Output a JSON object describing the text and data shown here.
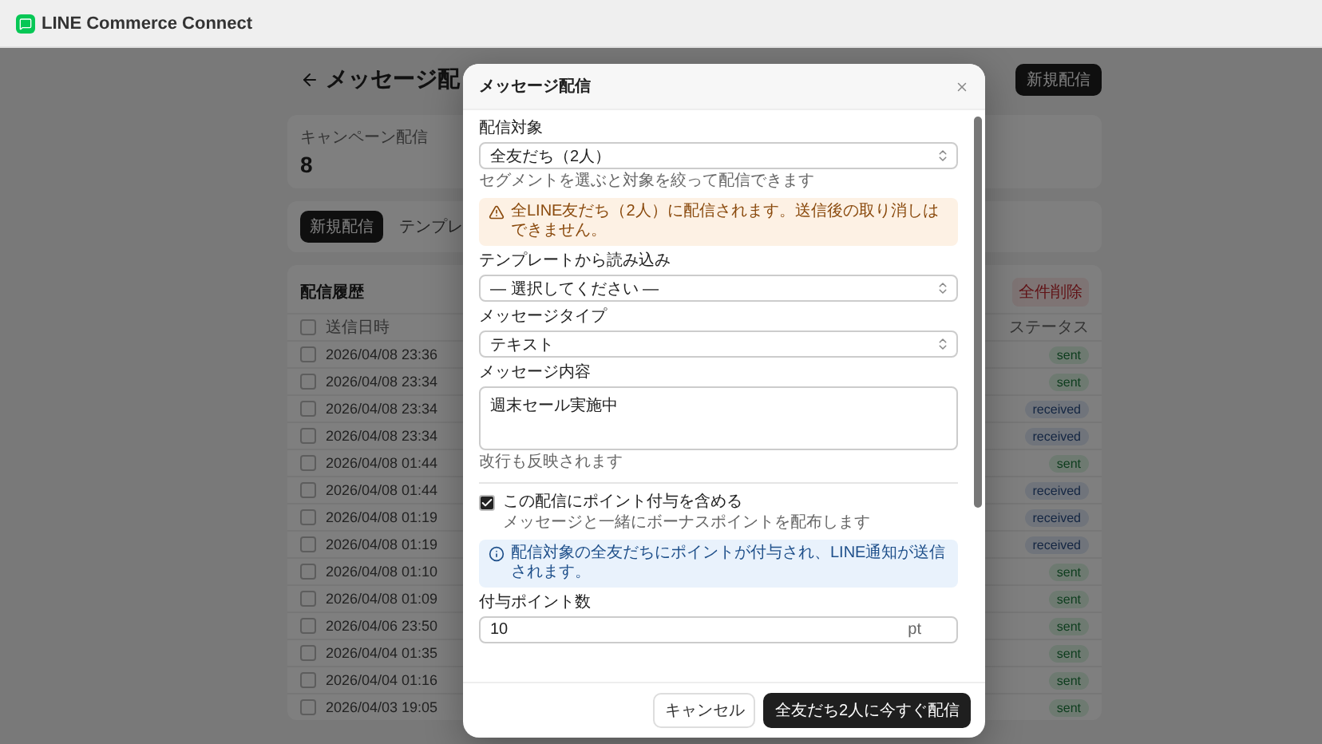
{
  "app_header": {
    "title": "LINE Commerce Connect"
  },
  "page": {
    "title": "メッセージ配",
    "new_button": "新規配信",
    "stat": {
      "label": "キャンペーン配信",
      "value": "8"
    },
    "tabs": [
      {
        "label": "新規配信",
        "selected": true
      },
      {
        "label": "テンプレ",
        "selected": false
      }
    ],
    "history": {
      "title": "配信履歴",
      "delete_all": "全件削除",
      "columns": [
        "送信日時",
        "ステータス"
      ],
      "header_checked": false,
      "rows": [
        {
          "date": "2026/04/08 23:36",
          "status": "sent",
          "kind": "success",
          "checked": false
        },
        {
          "date": "2026/04/08 23:34",
          "status": "sent",
          "kind": "success",
          "checked": false
        },
        {
          "date": "2026/04/08 23:34",
          "status": "received",
          "kind": "info",
          "checked": false
        },
        {
          "date": "2026/04/08 23:34",
          "status": "received",
          "kind": "info",
          "checked": false
        },
        {
          "date": "2026/04/08 01:44",
          "status": "sent",
          "kind": "success",
          "checked": false
        },
        {
          "date": "2026/04/08 01:44",
          "status": "received",
          "kind": "info",
          "checked": false
        },
        {
          "date": "2026/04/08 01:19",
          "status": "received",
          "kind": "info",
          "checked": false
        },
        {
          "date": "2026/04/08 01:19",
          "status": "received",
          "kind": "info",
          "checked": false
        },
        {
          "date": "2026/04/08 01:10",
          "status": "sent",
          "kind": "success",
          "checked": false
        },
        {
          "date": "2026/04/08 01:09",
          "status": "sent",
          "kind": "success",
          "checked": false
        },
        {
          "date": "2026/04/06 23:50",
          "status": "sent",
          "kind": "success",
          "checked": false
        },
        {
          "date": "2026/04/04 01:35",
          "status": "sent",
          "kind": "success",
          "checked": false
        },
        {
          "date": "2026/04/04 01:16",
          "status": "sent",
          "kind": "success",
          "checked": false
        },
        {
          "date": "2026/04/03 19:05",
          "status": "sent",
          "kind": "success",
          "checked": false
        }
      ]
    }
  },
  "modal": {
    "title": "メッセージ配信",
    "sections": [
      {
        "kind": "select",
        "label": "配信対象",
        "value": "全友だち（2人）",
        "help": "セグメントを選ぶと対象を絞って配信できます"
      },
      {
        "kind": "warning",
        "text": "全LINE友だち（2人）に配信されます。送信後の取り消しはできません。"
      },
      {
        "kind": "select",
        "label": "テンプレートから読み込み",
        "value": "— 選択してください —"
      },
      {
        "kind": "select",
        "label": "メッセージタイプ",
        "value": "テキスト"
      },
      {
        "kind": "textarea",
        "label": "メッセージ内容",
        "value": "週末セール実施中",
        "help": "改行も反映されます"
      },
      {
        "kind": "divider"
      },
      {
        "kind": "checkbox",
        "label": "この配信にポイント付与を含める",
        "description": "メッセージと一緒にボーナスポイントを配布します",
        "checked": true
      },
      {
        "kind": "info",
        "text": "配信対象の全友だちにポイントが付与され、LINE通知が送信されます。"
      },
      {
        "kind": "input",
        "label": "付与ポイント数",
        "value": "10",
        "suffix": "pt"
      }
    ],
    "buttons": [
      {
        "label": "キャンセル",
        "kind": "secondary"
      },
      {
        "label": "全友だち2人に今すぐ配信",
        "kind": "primary"
      }
    ]
  }
}
